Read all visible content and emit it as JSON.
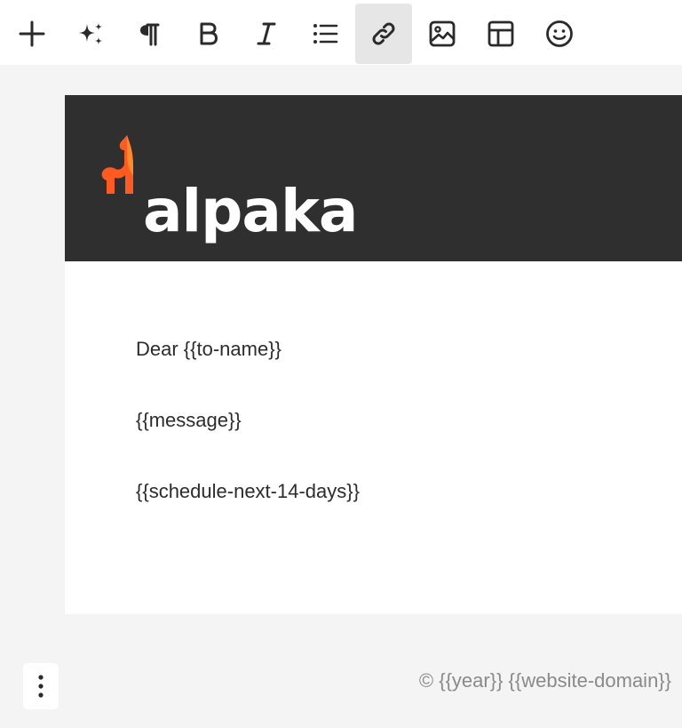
{
  "toolbar": {
    "tools": [
      {
        "icon": "plus-icon",
        "label": "Add block"
      },
      {
        "icon": "sparkles-icon",
        "label": "AI assist"
      },
      {
        "icon": "paragraph-icon",
        "label": "Paragraph"
      },
      {
        "icon": "bold-icon",
        "label": "Bold"
      },
      {
        "icon": "italic-icon",
        "label": "Italic"
      },
      {
        "icon": "list-icon",
        "label": "List"
      },
      {
        "icon": "link-icon",
        "label": "Link",
        "active": true
      },
      {
        "icon": "image-icon",
        "label": "Image"
      },
      {
        "icon": "table-icon",
        "label": "Table"
      },
      {
        "icon": "emoji-icon",
        "label": "Emoji"
      }
    ]
  },
  "email": {
    "header_bg": "#2f2f2f",
    "logo": {
      "text": "alpaka",
      "accent": "#ff5a1f",
      "accent_light": "#ff8a2a"
    },
    "body": {
      "greeting": "Dear {{to-name}}",
      "message": "{{message}}",
      "schedule": "{{schedule-next-14-days}}"
    }
  },
  "footer": {
    "copyright": "© {{year}} {{website-domain}}",
    "more_icon": "more-vertical-icon"
  }
}
